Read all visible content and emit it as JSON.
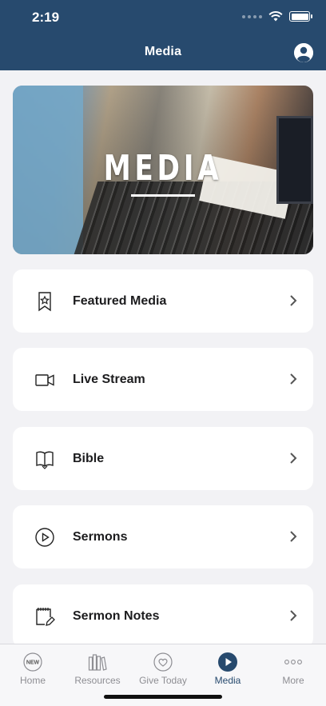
{
  "status_bar": {
    "time": "2:19"
  },
  "nav": {
    "title": "Media",
    "profile_icon": "person-circle-icon"
  },
  "hero": {
    "text": "MEDIA"
  },
  "menu": [
    {
      "label": "Featured Media",
      "icon": "bookmark-star-icon"
    },
    {
      "label": "Live Stream",
      "icon": "video-camera-icon"
    },
    {
      "label": "Bible",
      "icon": "open-book-icon"
    },
    {
      "label": "Sermons",
      "icon": "play-circle-icon"
    },
    {
      "label": "Sermon Notes",
      "icon": "notepad-pencil-icon"
    }
  ],
  "tabs": [
    {
      "label": "Home",
      "icon": "new-badge-icon",
      "badge": "NEW",
      "active": false
    },
    {
      "label": "Resources",
      "icon": "books-icon",
      "active": false
    },
    {
      "label": "Give Today",
      "icon": "heart-circle-icon",
      "active": false
    },
    {
      "label": "Media",
      "icon": "play-filled-icon",
      "active": true
    },
    {
      "label": "More",
      "icon": "ellipsis-icon",
      "active": false
    }
  ],
  "colors": {
    "header": "#274a6e",
    "background": "#f2f2f5",
    "accent": "#274a6e",
    "inactive": "#8e8e93"
  }
}
